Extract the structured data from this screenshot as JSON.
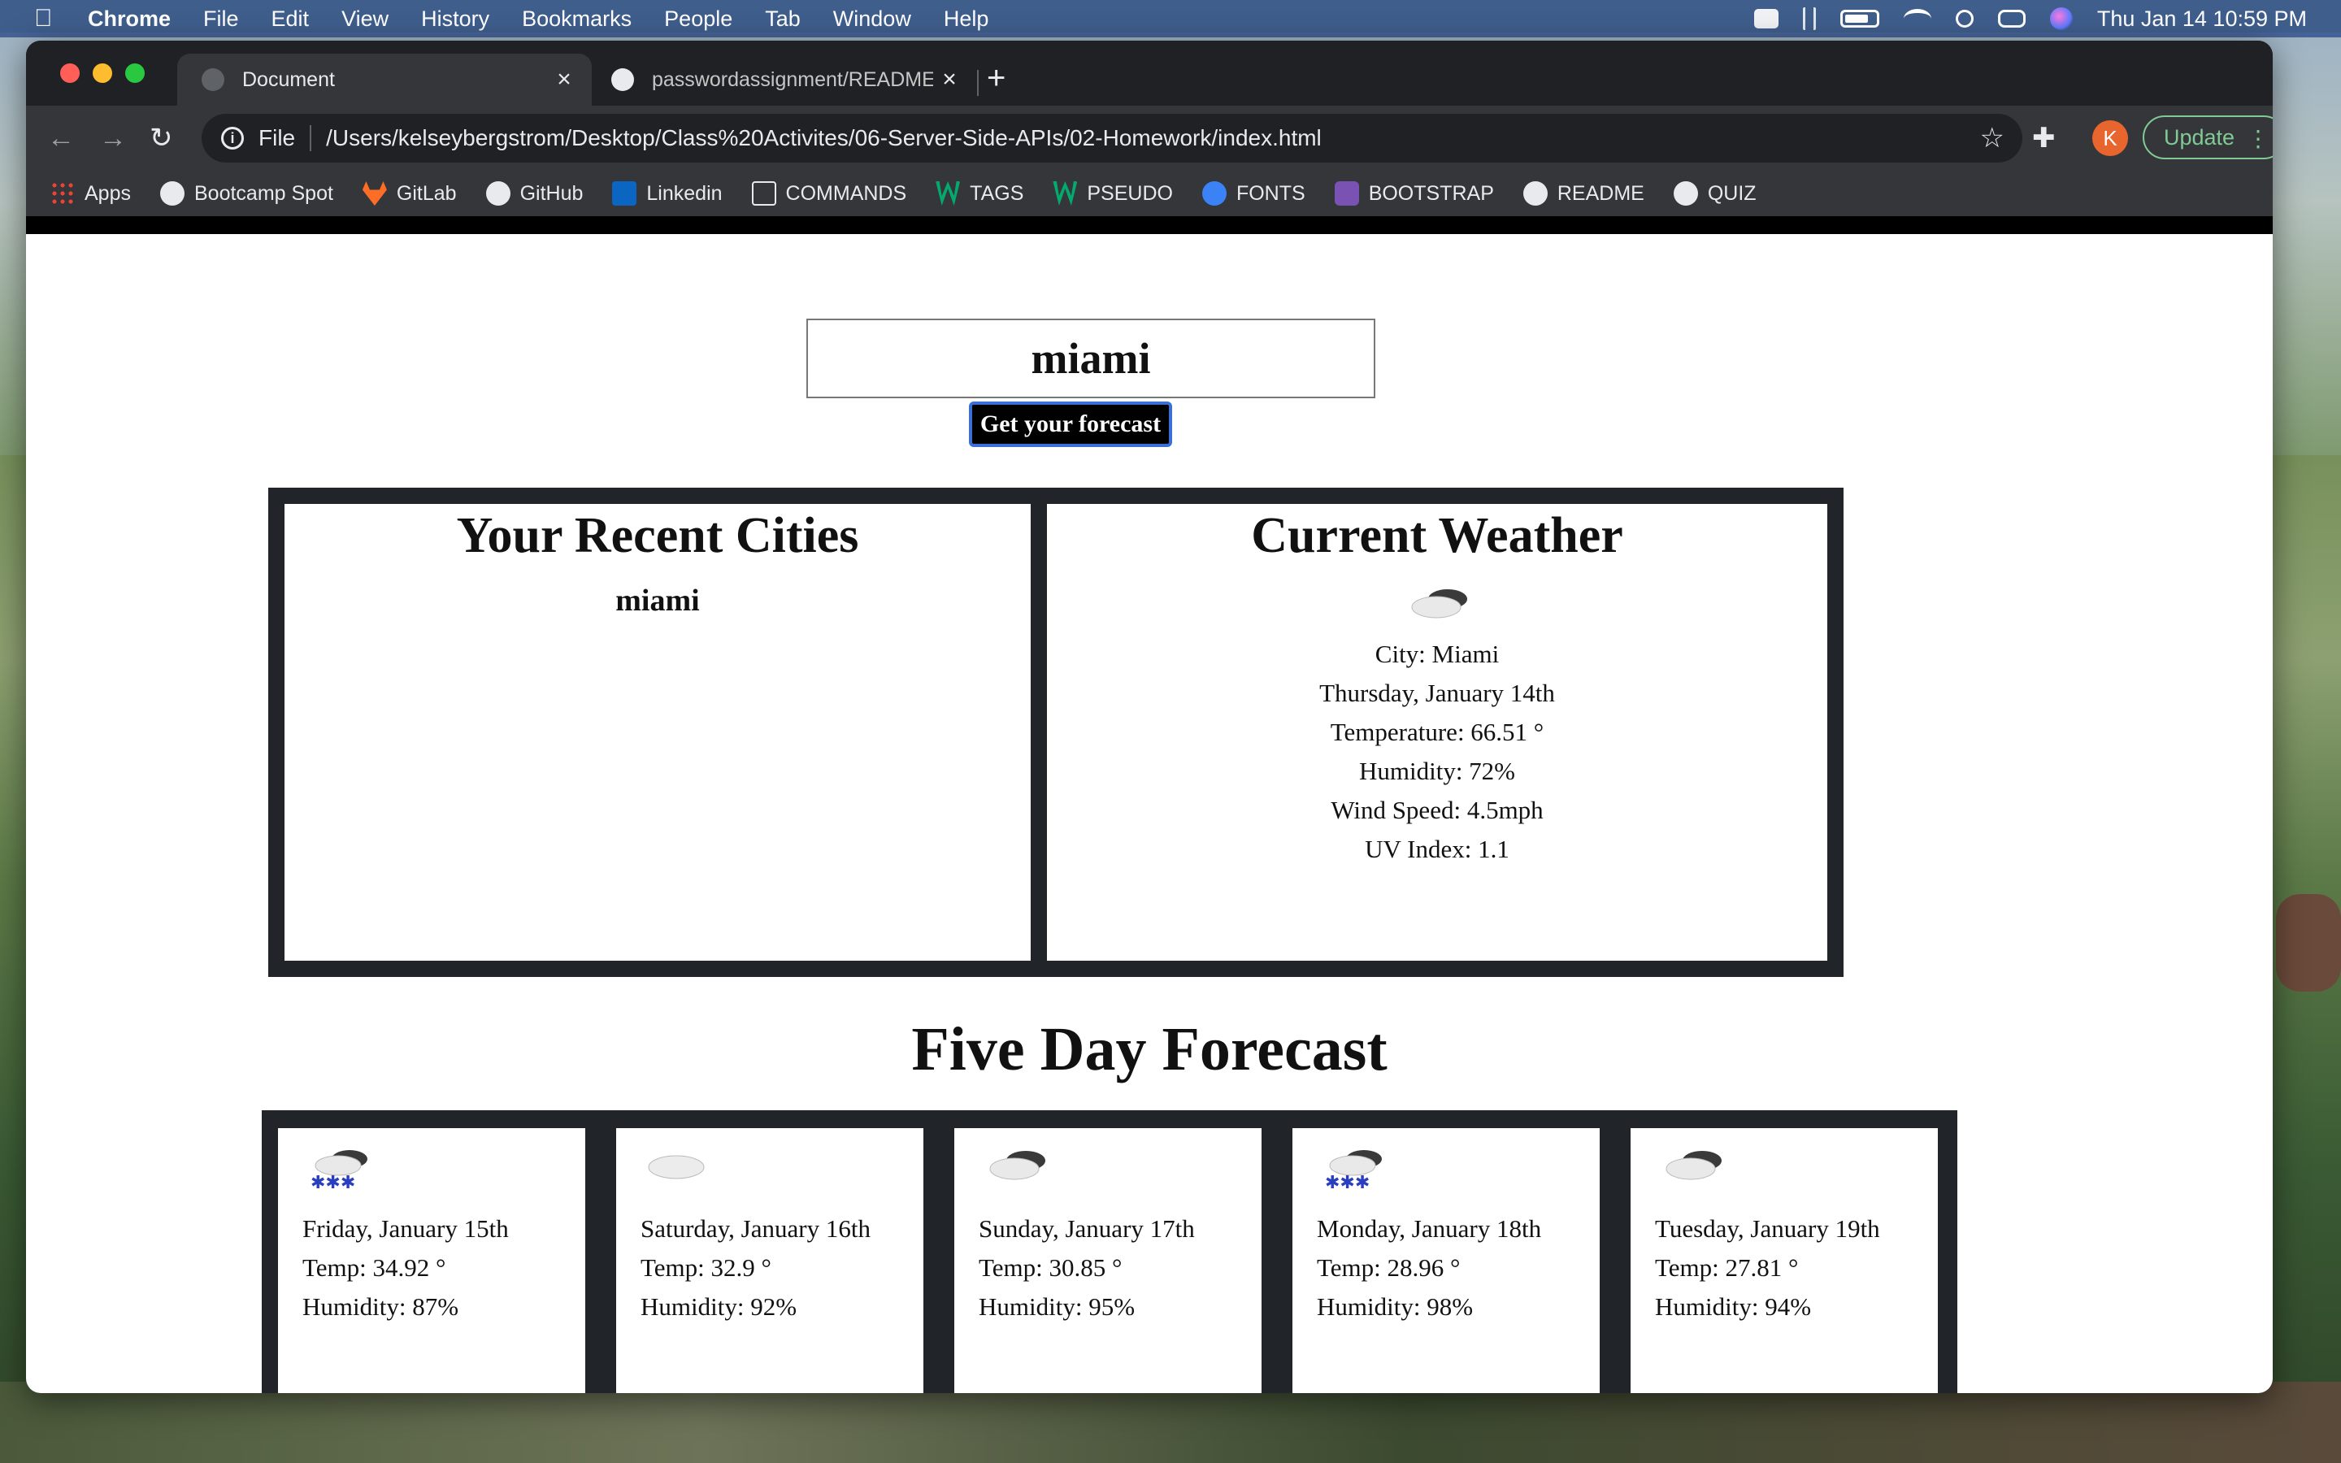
{
  "menubar": {
    "app": "Chrome",
    "items": [
      "File",
      "Edit",
      "View",
      "History",
      "Bookmarks",
      "People",
      "Tab",
      "Window",
      "Help"
    ],
    "datetime": "Thu Jan 14  10:59 PM"
  },
  "browser": {
    "tabs": [
      {
        "title": "Document"
      },
      {
        "title": "passwordassignment/README"
      }
    ],
    "address": {
      "scheme": "File",
      "url": "/Users/kelseybergstrom/Desktop/Class%20Activites/06-Server-Side-APIs/02-Homework/index.html"
    },
    "avatar_initial": "K",
    "update_label": "Update",
    "bookmarks": [
      {
        "label": "Apps",
        "icon": "apps-grid-icon"
      },
      {
        "label": "Bootcamp Spot",
        "icon": "globe-icon"
      },
      {
        "label": "GitLab",
        "icon": "gitlab-icon"
      },
      {
        "label": "GitHub",
        "icon": "github-icon"
      },
      {
        "label": "Linkedin",
        "icon": "linkedin-icon"
      },
      {
        "label": "COMMANDS",
        "icon": "terminal-icon"
      },
      {
        "label": "TAGS",
        "icon": "w3schools-icon"
      },
      {
        "label": "PSEUDO",
        "icon": "w3schools-icon"
      },
      {
        "label": "FONTS",
        "icon": "fonts-icon"
      },
      {
        "label": "BOOTSTRAP",
        "icon": "bootstrap-icon"
      },
      {
        "label": "README",
        "icon": "globe-icon"
      },
      {
        "label": "QUIZ",
        "icon": "globe-icon"
      }
    ]
  },
  "page": {
    "search": {
      "value": "miami"
    },
    "forecast_button": "Get your forecast",
    "recent": {
      "heading": "Your Recent Cities",
      "cities": [
        "miami"
      ]
    },
    "current": {
      "heading": "Current Weather",
      "icon": "cloudy-icon",
      "city": "City: Miami",
      "date": "Thursday, January 14th",
      "temperature": "Temperature: 66.51 °",
      "humidity": "Humidity: 72%",
      "wind": "Wind Speed: 4.5mph",
      "uv": "UV Index: 1.1"
    },
    "five_day_title": "Five Day Forecast",
    "days": [
      {
        "icon": "snow-icon",
        "date": "Friday, January 15th",
        "temp": "Temp: 34.92 °",
        "humidity": "Humidity: 87%"
      },
      {
        "icon": "cloud-icon",
        "date": "Saturday, January 16th",
        "temp": "Temp: 32.9 °",
        "humidity": "Humidity: 92%"
      },
      {
        "icon": "cloudy-icon",
        "date": "Sunday, January 17th",
        "temp": "Temp: 30.85 °",
        "humidity": "Humidity: 95%"
      },
      {
        "icon": "snow-icon",
        "date": "Monday, January 18th",
        "temp": "Temp: 28.96 °",
        "humidity": "Humidity: 98%"
      },
      {
        "icon": "cloudy-icon",
        "date": "Tuesday, January 19th",
        "temp": "Temp: 27.81 °",
        "humidity": "Humidity: 94%"
      }
    ]
  },
  "colors": {
    "panel_border": "#212529",
    "button_bg": "#000000",
    "button_outline": "#3b6fd6",
    "update_green": "#81c995",
    "avatar": "#e8652e"
  }
}
